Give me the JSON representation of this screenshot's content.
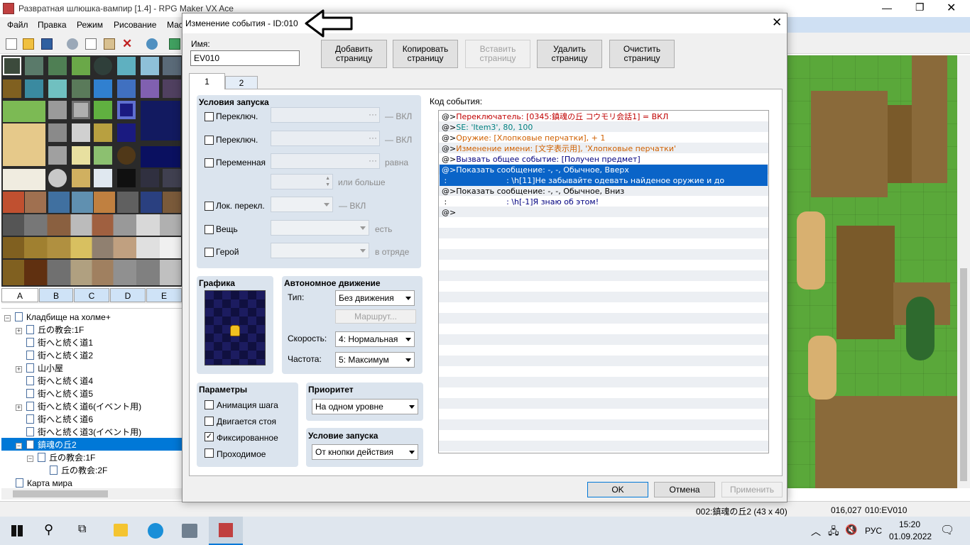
{
  "app": {
    "title": "Развратная шлюшка-вампир [1.4] - RPG Maker VX Ace",
    "menu": [
      "Файл",
      "Правка",
      "Режим",
      "Рисование",
      "Мас"
    ]
  },
  "tileset_tabs": [
    "A",
    "B",
    "C",
    "D",
    "E"
  ],
  "map_tree": [
    {
      "label": "Кладбище на холме+",
      "level": 0,
      "expander": "⊟"
    },
    {
      "label": "丘の教会:1F",
      "level": 1,
      "expander": "+"
    },
    {
      "label": "街へと続く道1",
      "level": 1,
      "expander": ""
    },
    {
      "label": "街へと続く道2",
      "level": 1,
      "expander": ""
    },
    {
      "label": "山小屋",
      "level": 1,
      "expander": "+"
    },
    {
      "label": "街へと続く道4",
      "level": 1,
      "expander": ""
    },
    {
      "label": "街へと続く道5",
      "level": 1,
      "expander": ""
    },
    {
      "label": "街へと続く道6(イベント用)",
      "level": 1,
      "expander": "+"
    },
    {
      "label": "街へと続く道6",
      "level": 1,
      "expander": ""
    },
    {
      "label": "街へと続く道3(イベント用)",
      "level": 1,
      "expander": ""
    },
    {
      "label": "鎮魂の丘2",
      "level": 1,
      "expander": "−",
      "selected": true
    },
    {
      "label": "丘の教会:1F",
      "level": 2,
      "expander": "−"
    },
    {
      "label": "丘の教会:2F",
      "level": 3,
      "expander": ""
    },
    {
      "label": "Карта мира",
      "level": 0,
      "expander": ""
    }
  ],
  "dialog": {
    "title": "Изменение события - ID:010",
    "name_label": "Имя:",
    "name_value": "EV010",
    "buttons": {
      "add": [
        "Добавить",
        "страницу"
      ],
      "copy": [
        "Копировать",
        "страницу"
      ],
      "paste": [
        "Вставить",
        "страницу"
      ],
      "delete": [
        "Удалить",
        "страницу"
      ],
      "clear": [
        "Очистить",
        "страницу"
      ]
    },
    "pages": [
      "1",
      "2"
    ],
    "conditions": {
      "title": "Условия запуска",
      "switch1": "Переключ.",
      "switch2": "Переключ.",
      "variable": "Переменная",
      "on1": "— ВКЛ",
      "on2": "— ВКЛ",
      "equals": "равна",
      "or_more": "или больше",
      "self_switch": "Лок. перекл.",
      "self_on": "— ВКЛ",
      "item": "Вещь",
      "item_suffix": "есть",
      "actor": "Герой",
      "actor_suffix": "в отряде",
      "ellipsis": "···"
    },
    "graphic_title": "Графика",
    "autonomous": {
      "title": "Автономное движение",
      "type_label": "Тип:",
      "type_value": "Без движения",
      "route_button": "Маршрут...",
      "speed_label": "Скорость:",
      "speed_value": "4: Нормальная",
      "freq_label": "Частота:",
      "freq_value": "5: Максимум"
    },
    "options": {
      "title": "Параметры",
      "walk_anim": "Анимация шага",
      "step_anim": "Двигается стоя",
      "direction_fix": "Фиксированное",
      "through": "Проходимое",
      "direction_fix_checked": true
    },
    "priority": {
      "title": "Приоритет",
      "value": "На одном уровне"
    },
    "trigger": {
      "title": "Условие запуска",
      "value": "От кнопки действия"
    },
    "code_label": "Код события:",
    "code_lines": [
      {
        "prefix": "@>",
        "text": "Переключатель: [0345:鎮魂の丘 コウモリ会話1] = ВКЛ",
        "color": "#c00000",
        "selected": false
      },
      {
        "prefix": "@>",
        "text": "SE: 'Item3', 80, 100",
        "color": "#008080",
        "selected": false
      },
      {
        "prefix": "@>",
        "text": "Оружие: [Хлопковые перчатки], + 1",
        "color": "#d06000",
        "selected": false
      },
      {
        "prefix": "@>",
        "text": "Изменение имени: [文字表示用], 'Хлопковые перчатки'",
        "color": "#d06000",
        "selected": false
      },
      {
        "prefix": "@>",
        "text": "Вызвать общее событие: [Получен предмет]",
        "color": "#000080",
        "selected": false
      },
      {
        "prefix": "@>",
        "text": "Показать сообщение: -, -, Обычное, Вверх",
        "color": "#ffffff",
        "selected": true
      },
      {
        "prefix": " :",
        "text": "                        : \\h[11]Не забывайте одевать найденое оружие и до",
        "color": "#ffffff",
        "selected": true
      },
      {
        "prefix": "@>",
        "text": "Показать сообщение: -, -, Обычное, Вниз",
        "color": "#000000",
        "selected": false
      },
      {
        "prefix": " :",
        "text": "                        : \\h[-1]Я знаю об этом!",
        "color": "#000080",
        "selected": false
      },
      {
        "prefix": "@>",
        "text": "",
        "color": "#000000",
        "selected": false
      }
    ],
    "ok": "OK",
    "cancel": "Отмена",
    "apply": "Применить"
  },
  "statusbar": {
    "map": "002:鎮魂の丘2 (43 x 40)",
    "coords": "016,027",
    "event": "010:EV010"
  },
  "taskbar": {
    "lang": "РУС",
    "time": "15:20",
    "date": "01.09.2022"
  },
  "colors": {
    "accent": "#0078d7",
    "selection": "#0a64c8",
    "dialog_bg": "#f0f0f0",
    "group_bg": "#dbe4ee"
  }
}
